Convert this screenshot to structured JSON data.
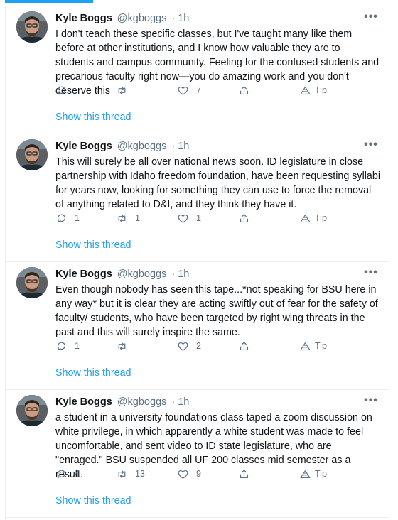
{
  "tweets": [
    {
      "name": "Kyle Boggs",
      "handle": "@kgboggs",
      "time": "· 1h",
      "text": "I don't teach these specific classes, but I've taught many like them before at other institutions, and I know how valuable they are to students and campus community. Feeling for the confused students and precarious faculty right now—you do amazing work and you don't deserve this",
      "replies": "",
      "retweets": "",
      "likes": "7",
      "tip": "Tip",
      "show_thread": "Show this thread"
    },
    {
      "name": "Kyle Boggs",
      "handle": "@kgboggs",
      "time": "· 1h",
      "text": "This will surely be all over national news soon. ID legislature in close partnership with Idaho freedom foundation, have been requesting syllabi for years now, looking for something they can use to force the removal of anything related to D&I, and they think they have it.",
      "replies": "1",
      "retweets": "1",
      "likes": "1",
      "tip": "Tip",
      "show_thread": "Show this thread"
    },
    {
      "name": "Kyle Boggs",
      "handle": "@kgboggs",
      "time": "· 1h",
      "text": "Even though nobody has seen this tape...*not speaking for BSU here in any way* but it is clear they are acting swiftly out of fear for the safety of faculty/ students, who have been targeted by right wing threats in the past and this will surely inspire the same.",
      "replies": "1",
      "retweets": "",
      "likes": "2",
      "tip": "Tip",
      "show_thread": "Show this thread"
    },
    {
      "name": "Kyle Boggs",
      "handle": "@kgboggs",
      "time": "· 1h",
      "text": "a student in a university foundations class taped a zoom discussion on white privilege, in which apparently a white student was made to feel uncomfortable, and sent video to ID state legislature, who are \"enraged.\" BSU suspended all UF 200 classes mid semester as a result.",
      "replies": "4",
      "retweets": "13",
      "likes": "9",
      "tip": "Tip",
      "show_thread": "Show this thread"
    }
  ],
  "more_glyph": "•••",
  "colors": {
    "accent": "#1da1f2",
    "muted": "#5b7083",
    "text": "#0f1419",
    "border": "#ebeef0"
  }
}
